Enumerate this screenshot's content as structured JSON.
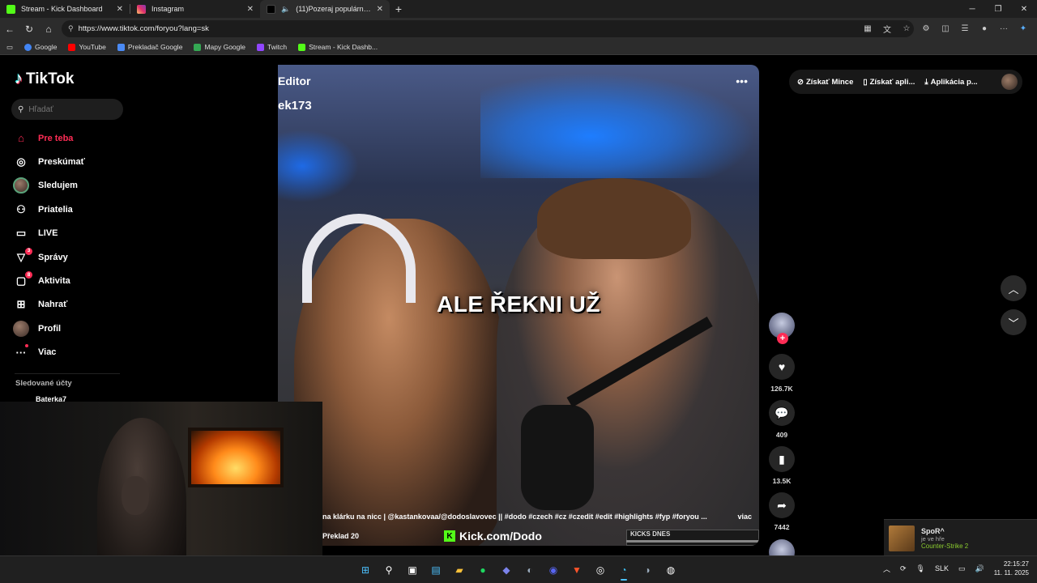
{
  "browser": {
    "tabs": [
      {
        "title": "Stream - Kick Dashboard",
        "color": "#53fc18",
        "active": false
      },
      {
        "title": "Instagram",
        "color": "#e1306c",
        "active": false
      },
      {
        "title": "(11)Pozeraj populárne videá",
        "color": "#000000",
        "active": true
      }
    ],
    "address": "https://www.tiktok.com/foryou?lang=sk",
    "bookmarks": [
      {
        "label": "Google",
        "color": "#4285f4"
      },
      {
        "label": "YouTube",
        "color": "#ff0000"
      },
      {
        "label": "Prekladač Google",
        "color": "#4a8af4"
      },
      {
        "label": "Mapy Google",
        "color": "#34a853"
      },
      {
        "label": "Twitch",
        "color": "#9146ff"
      },
      {
        "label": "Stream - Kick Dashb...",
        "color": "#53fc18"
      }
    ]
  },
  "tiktok": {
    "logo": "TikTok",
    "search_placeholder": "Hľadať",
    "nav": [
      {
        "label": "Pre teba",
        "icon": "home-icon",
        "glyph": "⌂",
        "active": true,
        "badge": ""
      },
      {
        "label": "Preskúmať",
        "icon": "compass-icon",
        "glyph": "◎",
        "active": false,
        "badge": ""
      },
      {
        "label": "Sledujem",
        "icon": "following-avatar-icon",
        "glyph": "",
        "active": false,
        "badge": ""
      },
      {
        "label": "Priatelia",
        "icon": "friends-icon",
        "glyph": "⚇",
        "active": false,
        "badge": ""
      },
      {
        "label": "LIVE",
        "icon": "live-tv-icon",
        "glyph": "▭",
        "active": false,
        "badge": ""
      },
      {
        "label": "Správy",
        "icon": "messages-icon",
        "glyph": "▽",
        "active": false,
        "badge": "3"
      },
      {
        "label": "Aktivita",
        "icon": "activity-icon",
        "glyph": "▢",
        "active": false,
        "badge": "8"
      },
      {
        "label": "Nahrať",
        "icon": "upload-icon",
        "glyph": "⊞",
        "active": false,
        "badge": ""
      },
      {
        "label": "Profil",
        "icon": "profile-avatar-icon",
        "glyph": "",
        "active": false,
        "badge": ""
      },
      {
        "label": "Viac",
        "icon": "more-icon",
        "glyph": "···",
        "active": false,
        "badge": ""
      }
    ],
    "followed_header": "Sledované účty",
    "followed": [
      "Baterka7"
    ],
    "top_right": {
      "coins": "Získať Mince",
      "app": "Získať apli...",
      "desktop_app": "Aplikácia p..."
    },
    "video": {
      "overlay_top1": "Editor",
      "overlay_top2": "ek173",
      "caption": "ALE ŘEKNI UŽ",
      "description": "na klárku na nicc | @kastankovaa/@dodoslavovec || #dodo #czech #cz #czedit #edit #highlights #fyp #foryou ...",
      "more_label": "viac",
      "kick_text": "Kick.com/Dodo",
      "kicks_text": "KICKS DNES",
      "preklad_text": "Překlad 20"
    },
    "actions": {
      "likes": "126.7K",
      "comments": "409",
      "saves": "13.5K",
      "shares": "7442"
    }
  },
  "notification": {
    "name": "SpoR^",
    "status": "je ve hře",
    "game": "Counter-Strike 2"
  },
  "taskbar": {
    "language": "SLK",
    "time": "22:15:27",
    "date": "11. 11. 2025"
  }
}
